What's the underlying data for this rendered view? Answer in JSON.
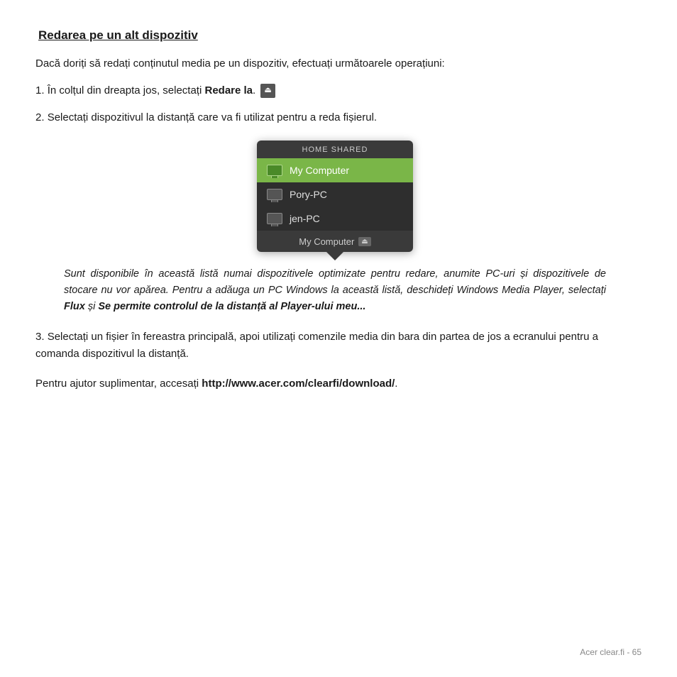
{
  "title": "Redarea pe un alt dispozitiv",
  "intro": "Dacă doriți să redați conținutul media pe un dispozitiv, efectuați următoarele operațiuni:",
  "steps": [
    {
      "number": "1.",
      "text_before": "În colțul din dreapta jos, selectați ",
      "bold": "Redare la",
      "text_after": ".",
      "has_icon": true
    },
    {
      "number": "2.",
      "text": "Selectați dispozitivul la distanță care va fi utilizat pentru a reda fișierul."
    }
  ],
  "popup": {
    "header": "HOME SHARED",
    "items": [
      {
        "label": "My Computer",
        "active": true
      },
      {
        "label": "Pory-PC",
        "active": false
      },
      {
        "label": "jen-PC",
        "active": false
      }
    ],
    "footer_label": "My Computer",
    "footer_icon": "⏏"
  },
  "note": {
    "text_before": "Sunt disponibile în această listă numai dispozitivele optimizate pentru redare, anumite PC-uri și dispozitivele de stocare nu vor apărea. Pentru a adăuga un PC Windows la această listă, deschideți Windows Media Player, selectați ",
    "bold1": "Flux",
    "text_mid": " și ",
    "bold2": "Se permite controlul de la distanță al Player-ului meu...",
    "text_after": ""
  },
  "step3": {
    "number": "3.",
    "text": "Selectați un fișier în fereastra principală, apoi utilizați comenzile media din bara din partea de jos a ecranului pentru a comanda dispozitivul la distanță."
  },
  "footer": {
    "text_before": "Pentru ajutor suplimentar, accesați ",
    "link": "http://www.acer.com/clearfi/download/",
    "text_after": "."
  },
  "page_number": "Acer clear.fi -  65",
  "play_icon_symbol": "⏏"
}
